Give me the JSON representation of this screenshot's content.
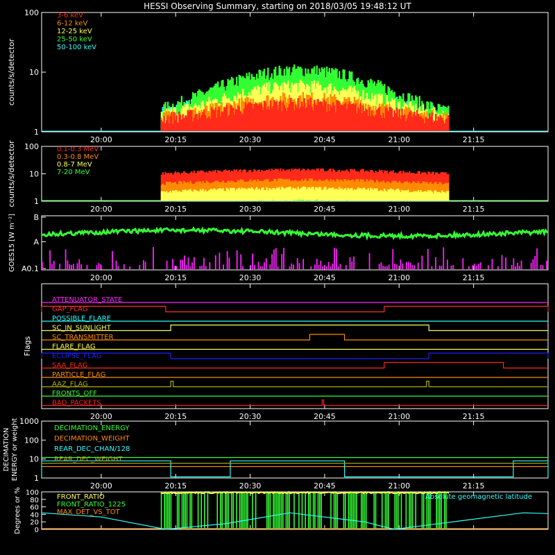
{
  "title": "HESSI Observing Summary, starting on 2018/03/05 19:48:12 UT",
  "time_ticks": [
    "20:00",
    "20:15",
    "20:30",
    "20:45",
    "21:00",
    "21:15"
  ],
  "chart_data": [
    {
      "type": "line",
      "ylabel": "counts/s/detector",
      "ylim": [
        1,
        100
      ],
      "yscale": "log",
      "yticks": [
        "1",
        "10",
        "100"
      ],
      "data_span_min": [
        12,
        70
      ],
      "series": [
        {
          "name": "3-6 keV",
          "color": "#ff2a1a",
          "peak": 3.0
        },
        {
          "name": "6-12 keV",
          "color": "#ff8c00",
          "peak": 3.8
        },
        {
          "name": "12-25 keV",
          "color": "#ffff55",
          "peak": 6.0
        },
        {
          "name": "25-50 keV",
          "color": "#33ff33",
          "peak": 11.0
        },
        {
          "name": "50-100 keV",
          "color": "#33ffff",
          "peak": 7.5
        }
      ]
    },
    {
      "type": "line",
      "ylabel": "counts/s/detector",
      "ylim": [
        1,
        100
      ],
      "yscale": "log",
      "yticks": [
        "1",
        "10",
        "100"
      ],
      "data_span_min": [
        12,
        70
      ],
      "series": [
        {
          "name": "0.1-0.3 MeV",
          "color": "#ff2a1a",
          "peak": 14.0
        },
        {
          "name": "0.3-0.8 MeV",
          "color": "#ff8c00",
          "peak": 6.0
        },
        {
          "name": "0.8-7 MeV",
          "color": "#ffff55",
          "peak": 3.0
        },
        {
          "name": "7-20 MeV",
          "color": "#33ff33",
          "peak": 1.0
        }
      ]
    },
    {
      "type": "line",
      "ylabel": "GOES15 [W m⁻²]",
      "yticks": [
        "A0.1",
        "A",
        "B"
      ],
      "series": [
        {
          "color": "#33ff33",
          "level": "A-class, ~A6"
        },
        {
          "color": "#ff22ff",
          "level": "near A0.1 with spikes"
        }
      ]
    },
    {
      "type": "line",
      "ylabel": "Flags",
      "flags": [
        {
          "name": "ATTENUATOR_STATE",
          "color": "#ff22ff",
          "on": []
        },
        {
          "name": "GAP_FLAG",
          "color": "#ff3020",
          "on": [
            [
              -12,
              13
            ],
            [
              57,
              90
            ]
          ]
        },
        {
          "name": "POSSIBLE_FLARE",
          "color": "#33ffff",
          "on": []
        },
        {
          "name": "SC_IN_SUNLIGHT",
          "color": "#ffff55",
          "on": [
            [
              14,
              66
            ]
          ]
        },
        {
          "name": "SC_TRANSMITTER",
          "color": "#ff8c00",
          "on": [
            [
              42,
              49
            ]
          ]
        },
        {
          "name": "FLARE_FLAG",
          "color": "#ffff55",
          "on": []
        },
        {
          "name": "ECLIPSE_FLAG",
          "color": "#2020ff",
          "on": [
            [
              -12,
              14
            ],
            [
              66,
              90
            ]
          ]
        },
        {
          "name": "SAA_FLAG",
          "color": "#ff2a1a",
          "on": [
            [
              57,
              81
            ]
          ]
        },
        {
          "name": "PARTICLE_FLAG",
          "color": "#ff8c00",
          "on": []
        },
        {
          "name": "AAZ_FLAG",
          "color": "#b0b000",
          "on": [
            [
              14,
              14.5
            ],
            [
              65.5,
              66
            ]
          ]
        },
        {
          "name": "FRONTS_OFF",
          "color": "#33ff33",
          "on": []
        },
        {
          "name": "BAD_PACKETS",
          "color": "#ff2020",
          "on": [
            [
              44.5,
              44.8
            ]
          ]
        }
      ]
    },
    {
      "type": "line",
      "ylabel": "DECIMATION ENERGY or weight",
      "ylim": [
        1,
        1000
      ],
      "yscale": "log",
      "yticks": [
        "1",
        "10",
        "100",
        "1000"
      ],
      "series": [
        {
          "name": "DECIMATION_ENERGY",
          "color": "#33ff33",
          "value": 12
        },
        {
          "name": "DECIMATION_WEIGHT",
          "color": "#ff8c00",
          "value": 4
        },
        {
          "name": "REAR_DEC_CHAN/128",
          "color": "#33ffff",
          "value": 8,
          "high_intervals": [
            [
              -12,
              14
            ],
            [
              26,
              49
            ],
            [
              83,
              90
            ]
          ]
        },
        {
          "name": "REAR_DEC_WEIGHT",
          "color": "#aaaa22",
          "value": 6
        }
      ]
    },
    {
      "type": "line",
      "ylabel": "Degrees or %",
      "ylim": [
        0,
        100
      ],
      "yticks": [
        "0",
        "20",
        "40",
        "60",
        "80",
        "100"
      ],
      "annotation": "Absolute geomagnetic latitude",
      "series": [
        {
          "name": "FRONT_RATIO",
          "color": "#ffff55"
        },
        {
          "name": "FRONT_RATIO_1225",
          "color": "#33ff33"
        },
        {
          "name": "MAX_DET_VS_TOT",
          "color": "#ff8c00"
        },
        {
          "color": "#33ffff",
          "values_deg": [
            [
              -12,
              44
            ],
            [
              0,
              33
            ],
            [
              13,
              0
            ],
            [
              25,
              15
            ],
            [
              38,
              44
            ],
            [
              53,
              20
            ],
            [
              59,
              0
            ],
            [
              72,
              22
            ],
            [
              85,
              44
            ],
            [
              90,
              42
            ]
          ]
        }
      ]
    }
  ]
}
